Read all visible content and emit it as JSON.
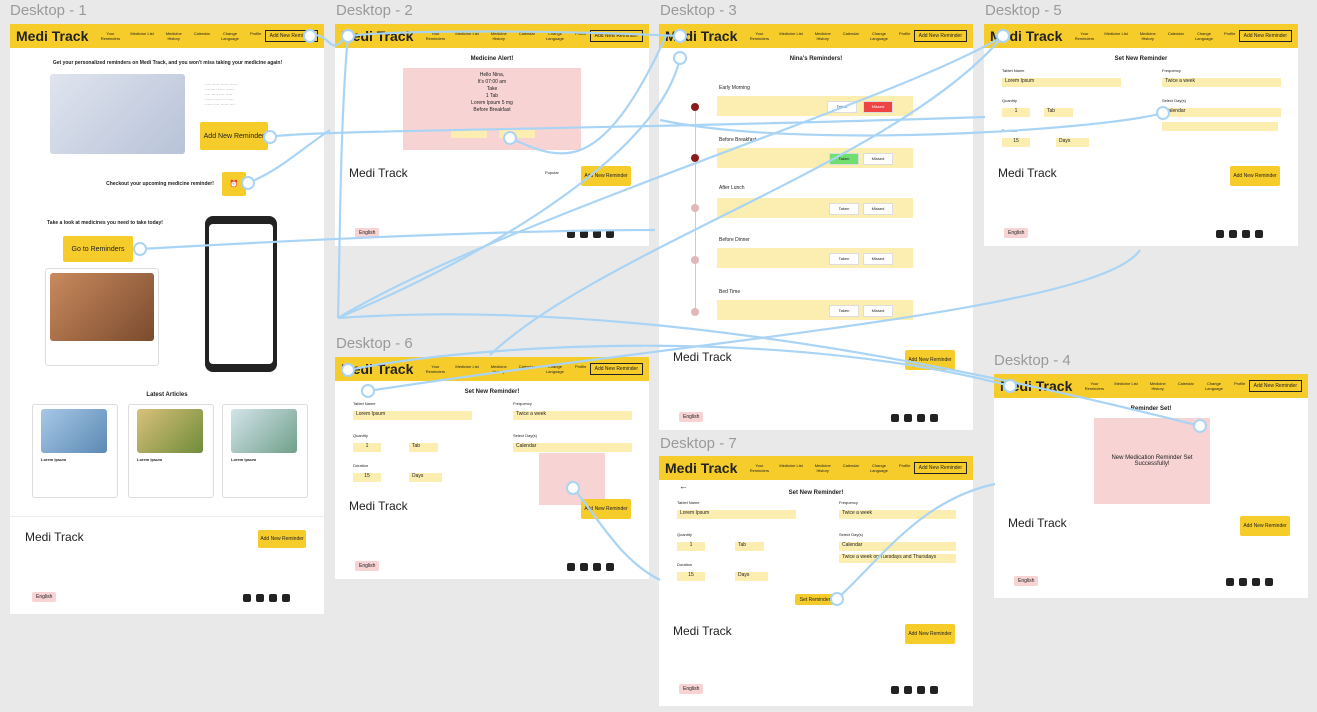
{
  "frames": {
    "d1": "Desktop - 1",
    "d2": "Desktop - 2",
    "d3": "Desktop - 3",
    "d4": "Desktop - 4",
    "d5": "Desktop - 5",
    "d6": "Desktop - 6",
    "d7": "Desktop - 7"
  },
  "brand": "Medi Track",
  "nav": {
    "your_reminders": "Your Reminders",
    "medicine_list": "Medicine List",
    "medicine_history": "Medicine History",
    "calendar": "Calendar",
    "change_language": "Change Language",
    "profile": "Profile",
    "add_new_reminder": "Add New Reminder"
  },
  "d1": {
    "headline": "Get your personalized reminders on Medi Track, and you won't miss taking your medicine again!",
    "add_btn": "Add New Reminder",
    "checkout": "Checkout your upcoming medicine reminder!",
    "take_look": "Take a look at medicines you need to take today!",
    "go_btn": "Go to Reminders",
    "latest": "Latest Articles",
    "lorem": "Lorem Ipsum",
    "language": "English"
  },
  "d2": {
    "title": "Medicine Alert!",
    "line1": "Hello Nina,",
    "line2": "It's 07:00 am",
    "line3": "Take",
    "line4": "1 Tab",
    "line5": "Lorem Ipsum 5 mg",
    "line6": "Before Breakfast",
    "footer_popular": "Popular",
    "language": "English"
  },
  "d3": {
    "title": "Nina's Reminders!",
    "sections": [
      "Early Morning",
      "Before Breakfast",
      "After Lunch",
      "Before Dinner",
      "Bed Time"
    ],
    "taken": "Taken",
    "missed": "Missed",
    "language": "English"
  },
  "d4": {
    "title": "Reminder Set!",
    "message": "New Medication Reminder Set Successfully!",
    "language": "English"
  },
  "d5": {
    "title": "Set New Reminder",
    "tablet_name": "Tablet Name",
    "tablet_value": "Lorem Ipsum",
    "frequency": "Frequency",
    "frequency_value": "Twice a week",
    "quantity": "Quantity",
    "quantity_value": "1",
    "quantity_unit": "Tab",
    "select_days": "Select Day(s)",
    "days_value": "Calendar",
    "duration": "Duration",
    "duration_value": "15",
    "duration_unit": "Days",
    "language": "English"
  },
  "d6": {
    "title": "Set New Reminder!",
    "tablet_name": "Tablet Name",
    "tablet_value": "Lorem Ipsum",
    "frequency": "Frequency",
    "frequency_value": "Twice a week",
    "quantity": "Quantity",
    "quantity_value": "1",
    "quantity_unit": "Tab",
    "select_days": "Select Day(s)",
    "days_value": "Calendar",
    "duration": "Duration",
    "duration_value": "15",
    "duration_unit": "Days",
    "language": "English"
  },
  "d7": {
    "title": "Set New Reminder!",
    "tablet_name": "Tablet Name",
    "tablet_value": "Lorem Ipsum",
    "frequency": "Frequency",
    "frequency_value": "Twice a week",
    "quantity": "Quantity",
    "quantity_value": "1",
    "quantity_unit": "Tab",
    "select_days": "Select Day(s)",
    "days_value": "Calendar",
    "days_summary": "Twice a week on Tuesdays and Thursdays",
    "duration": "Duration",
    "duration_value": "15",
    "duration_unit": "Days",
    "set_btn": "Set Reminder",
    "language": "English"
  },
  "colors": {
    "accent": "#f6cc2b",
    "pink": "#f7d3d3",
    "wire": "#a9d4f5"
  }
}
